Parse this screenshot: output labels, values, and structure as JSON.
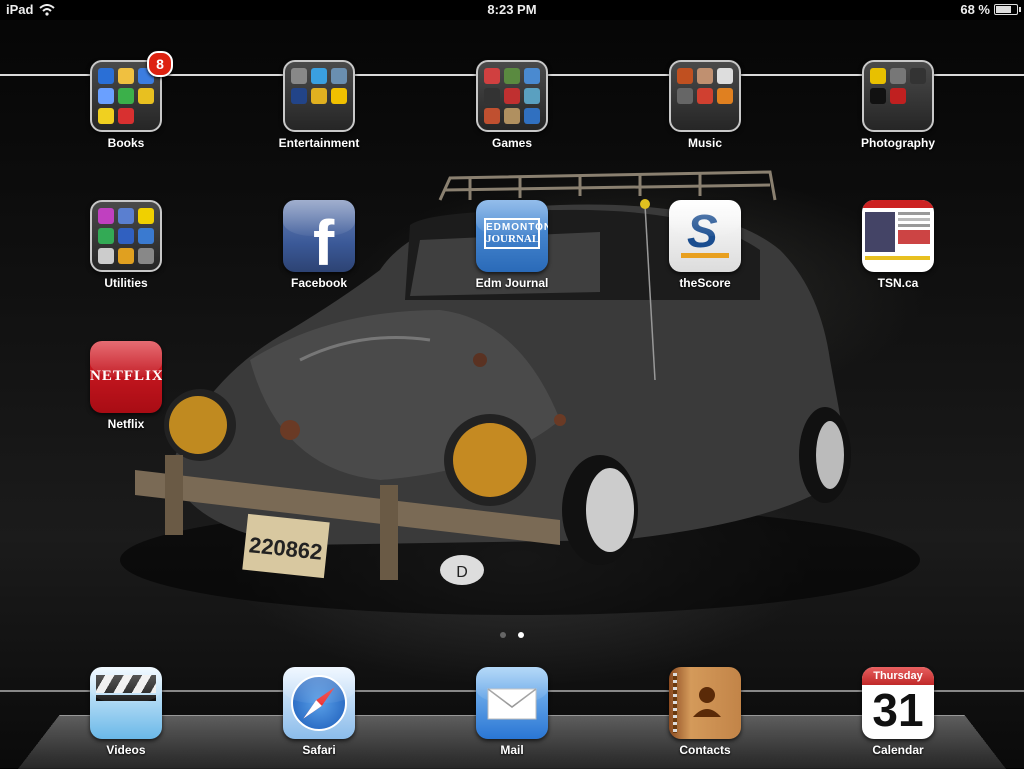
{
  "status_bar": {
    "device": "iPad",
    "time": "8:23 PM",
    "battery_text": "68 %",
    "battery_level": 0.68
  },
  "folders": [
    {
      "label": "Books",
      "badge": "8",
      "minis": [
        "#2a6fd6",
        "#f0c040",
        "#3b7de0",
        "#6aa0ff",
        "#3bb04a",
        "#e8c020",
        "#f0d020",
        "#d83030",
        ""
      ]
    },
    {
      "label": "Entertainment",
      "badge": "",
      "minis": [
        "#888",
        "#3aa0e0",
        "#6a8fb0",
        "#224488",
        "#e0b020",
        "#f0c000",
        "",
        "",
        ""
      ]
    },
    {
      "label": "Games",
      "badge": "",
      "minis": [
        "#d04040",
        "#5a8a40",
        "#4a8ad0",
        "#333",
        "#c03030",
        "#5aa0c0",
        "#c05030",
        "#b09060",
        "#3070c0"
      ]
    },
    {
      "label": "Music",
      "badge": "",
      "minis": [
        "#c05020",
        "#c09070",
        "#ddd",
        "#666",
        "#d04030",
        "#e08020",
        "",
        "",
        ""
      ]
    },
    {
      "label": "Photography",
      "badge": "",
      "minis": [
        "#e8c000",
        "#777",
        "#333",
        "#111",
        "#c02020",
        "",
        "",
        "",
        ""
      ]
    },
    {
      "label": "Utilities",
      "badge": "",
      "minis": [
        "#c040c0",
        "#5a7fd0",
        "#f0d000",
        "#3a5",
        "#3060c0",
        "#3a7ad0",
        "#ccc",
        "#e0a020",
        "#888"
      ]
    }
  ],
  "apps": {
    "facebook": {
      "label": "Facebook",
      "glyph": "f"
    },
    "edm_journal": {
      "label": "Edm Journal",
      "logo_line1": "EDMONTON",
      "logo_line2": "JOURNAL"
    },
    "thescore": {
      "label": "theScore",
      "glyph": "S"
    },
    "tsn": {
      "label": "TSN.ca"
    },
    "netflix": {
      "label": "Netflix",
      "logo": "NETFLIX"
    }
  },
  "dock": {
    "videos": {
      "label": "Videos"
    },
    "safari": {
      "label": "Safari"
    },
    "mail": {
      "label": "Mail"
    },
    "contacts": {
      "label": "Contacts"
    },
    "calendar": {
      "label": "Calendar",
      "weekday": "Thursday",
      "day": "31"
    }
  },
  "wallpaper": {
    "plate": "220862",
    "country_badge": "D"
  },
  "page_indicator": {
    "pages": 2,
    "current": 2
  },
  "colors": {
    "badge": "#dd2211",
    "netflix_red": "#c8101a",
    "facebook_blue": "#3b5998"
  }
}
